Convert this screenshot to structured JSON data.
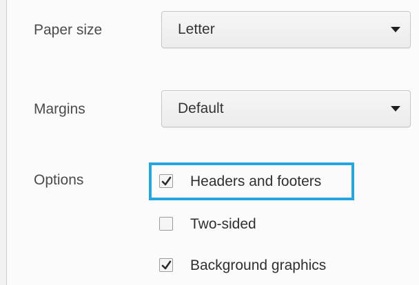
{
  "paper_size": {
    "label": "Paper size",
    "value": "Letter",
    "icon": "chevron-down-icon"
  },
  "margins": {
    "label": "Margins",
    "value": "Default",
    "icon": "chevron-down-icon"
  },
  "options": {
    "label": "Options",
    "items": [
      {
        "label": "Headers and footers",
        "checked": true
      },
      {
        "label": "Two-sided",
        "checked": false
      },
      {
        "label": "Background graphics",
        "checked": true
      }
    ],
    "highlight_color": "#25a6e0"
  }
}
